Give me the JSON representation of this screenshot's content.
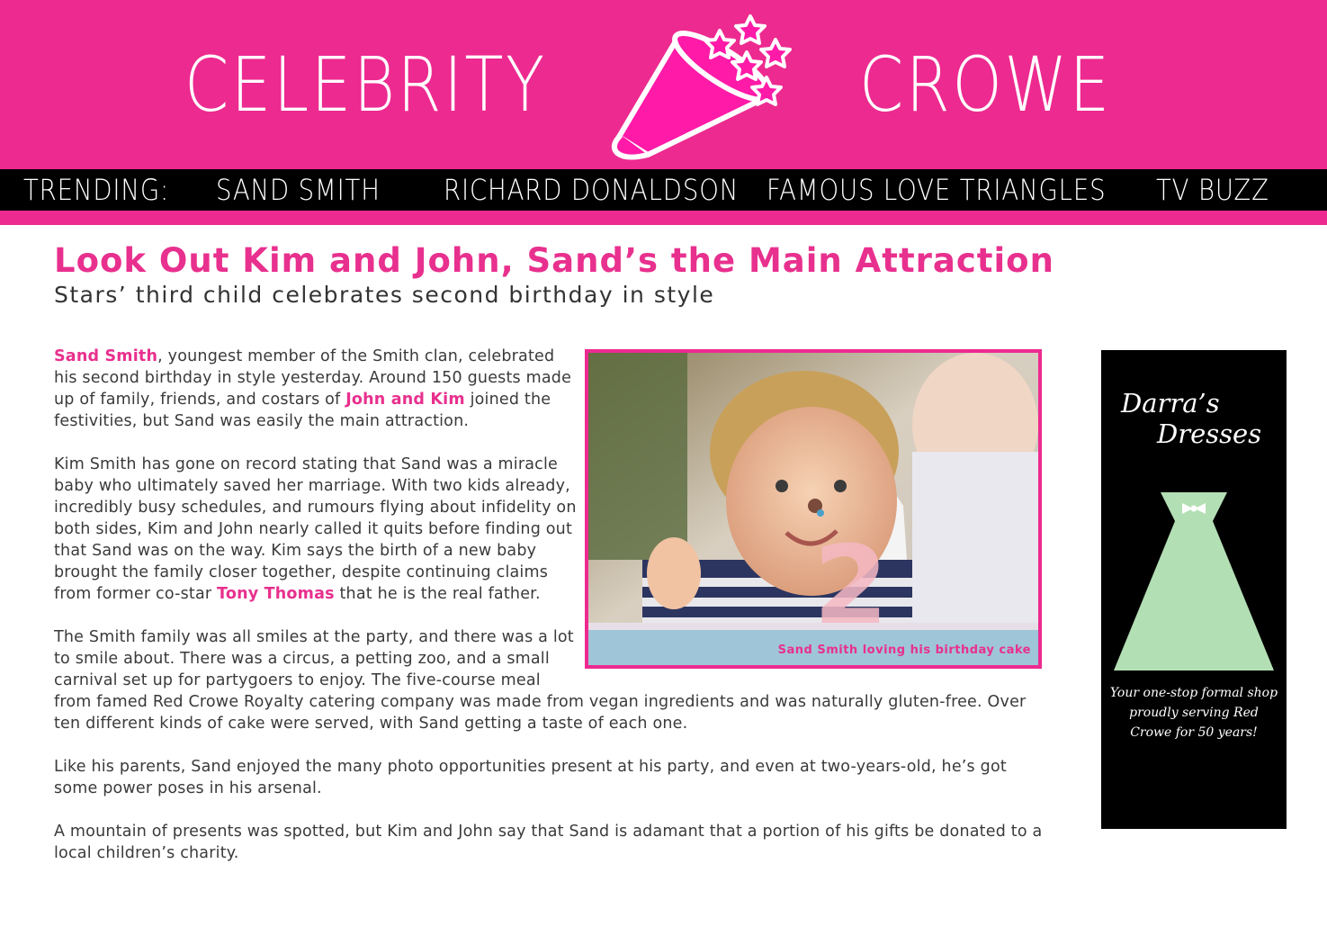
{
  "header": {
    "logo_left": "CELEBRITY",
    "logo_right": "CROWE"
  },
  "nav": {
    "label": "TRENDING:",
    "items": [
      "SAND SMITH",
      "RICHARD DONALDSON",
      "FAMOUS LOVE TRIANGLES",
      "TV BUZZ"
    ]
  },
  "article": {
    "headline": "Look Out Kim and John, Sand’s the Main Attraction",
    "subhead": "Stars’ third child celebrates second birthday in style",
    "p1": {
      "link1": "Sand Smith",
      "t1": ", youngest member of the Smith clan, celebrated his second birthday in style yesterday.  Around 150 guests made up of family, friends, and costars of ",
      "link2": "John and Kim",
      "t2": " joined the festivities, but Sand was easily the main attraction."
    },
    "p2": {
      "t1": "Kim Smith has gone on record stating that Sand was a miracle baby who ultimately saved her marriage.  With two kids already, incredibly busy schedules, and rumours flying about infidelity on both sides, Kim and John nearly called it quits before finding out that Sand was on the way.  Kim says the birth of a new baby brought the family closer together, despite continuing claims from former co-star ",
      "link1": "Tony Thomas",
      "t2": " that he is the real father."
    },
    "p3": "The Smith family was all smiles at the party, and there was a lot to smile about.  There was a circus, a petting zoo, and a small carnival set up for partygoers to enjoy.  The five-course meal from famed Red Crowe Royalty catering company was made from vegan ingredients and was naturally gluten-free.  Over ten different kinds of cake were served, with Sand getting a taste of each one.",
    "p4": "Like his parents, Sand enjoyed the many photo opportunities present at his party, and even at two-years-old, he’s got some power poses in his arsenal.",
    "p5": "A mountain of presents was spotted, but Kim and John say that Sand is adamant that a portion of his gifts be donated to a local children’s charity.",
    "photo_caption": "Sand Smith loving his birthday cake"
  },
  "ad": {
    "title_line1": "Darra’s",
    "title_line2": "Dresses",
    "tagline": "Your one-stop formal shop proudly serving Red Crowe for 50 years!"
  },
  "colors": {
    "brand_pink": "#ed2a90",
    "nav_black": "#000000",
    "dress_mint": "#b3dfb5"
  }
}
